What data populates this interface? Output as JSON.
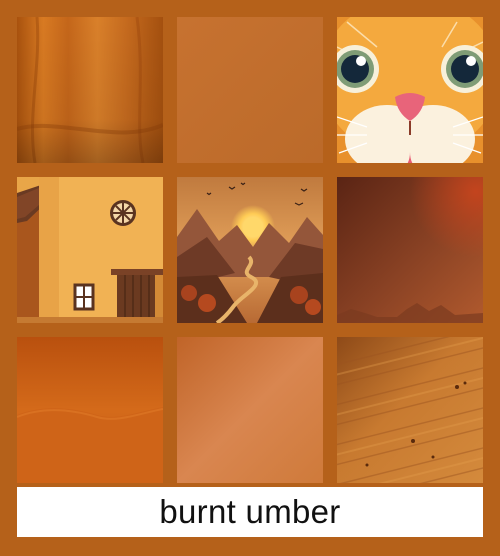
{
  "caption": "burnt umber",
  "colors": {
    "frame": "#b5611a",
    "caption_background": "#ffffff",
    "caption_text": "#111111"
  },
  "tiles": [
    {
      "name": "orange-fabric-drape",
      "dominant": "#c86a1c"
    },
    {
      "name": "flat-burnt-orange-swatch",
      "dominant": "#c27030"
    },
    {
      "name": "cartoon-cat-face",
      "dominant": "#f2a23a"
    },
    {
      "name": "orange-house-with-round-window",
      "dominant": "#e8a245"
    },
    {
      "name": "sunset-valley-winding-road",
      "dominant": "#a8582a"
    },
    {
      "name": "dark-rust-gradient-landscape",
      "dominant": "#7e3a1c"
    },
    {
      "name": "burnt-orange-gradient-dunes",
      "dominant": "#c55e14"
    },
    {
      "name": "soft-orange-gradient",
      "dominant": "#d07a3e"
    },
    {
      "name": "wood-grain-surface",
      "dominant": "#c27224"
    }
  ]
}
